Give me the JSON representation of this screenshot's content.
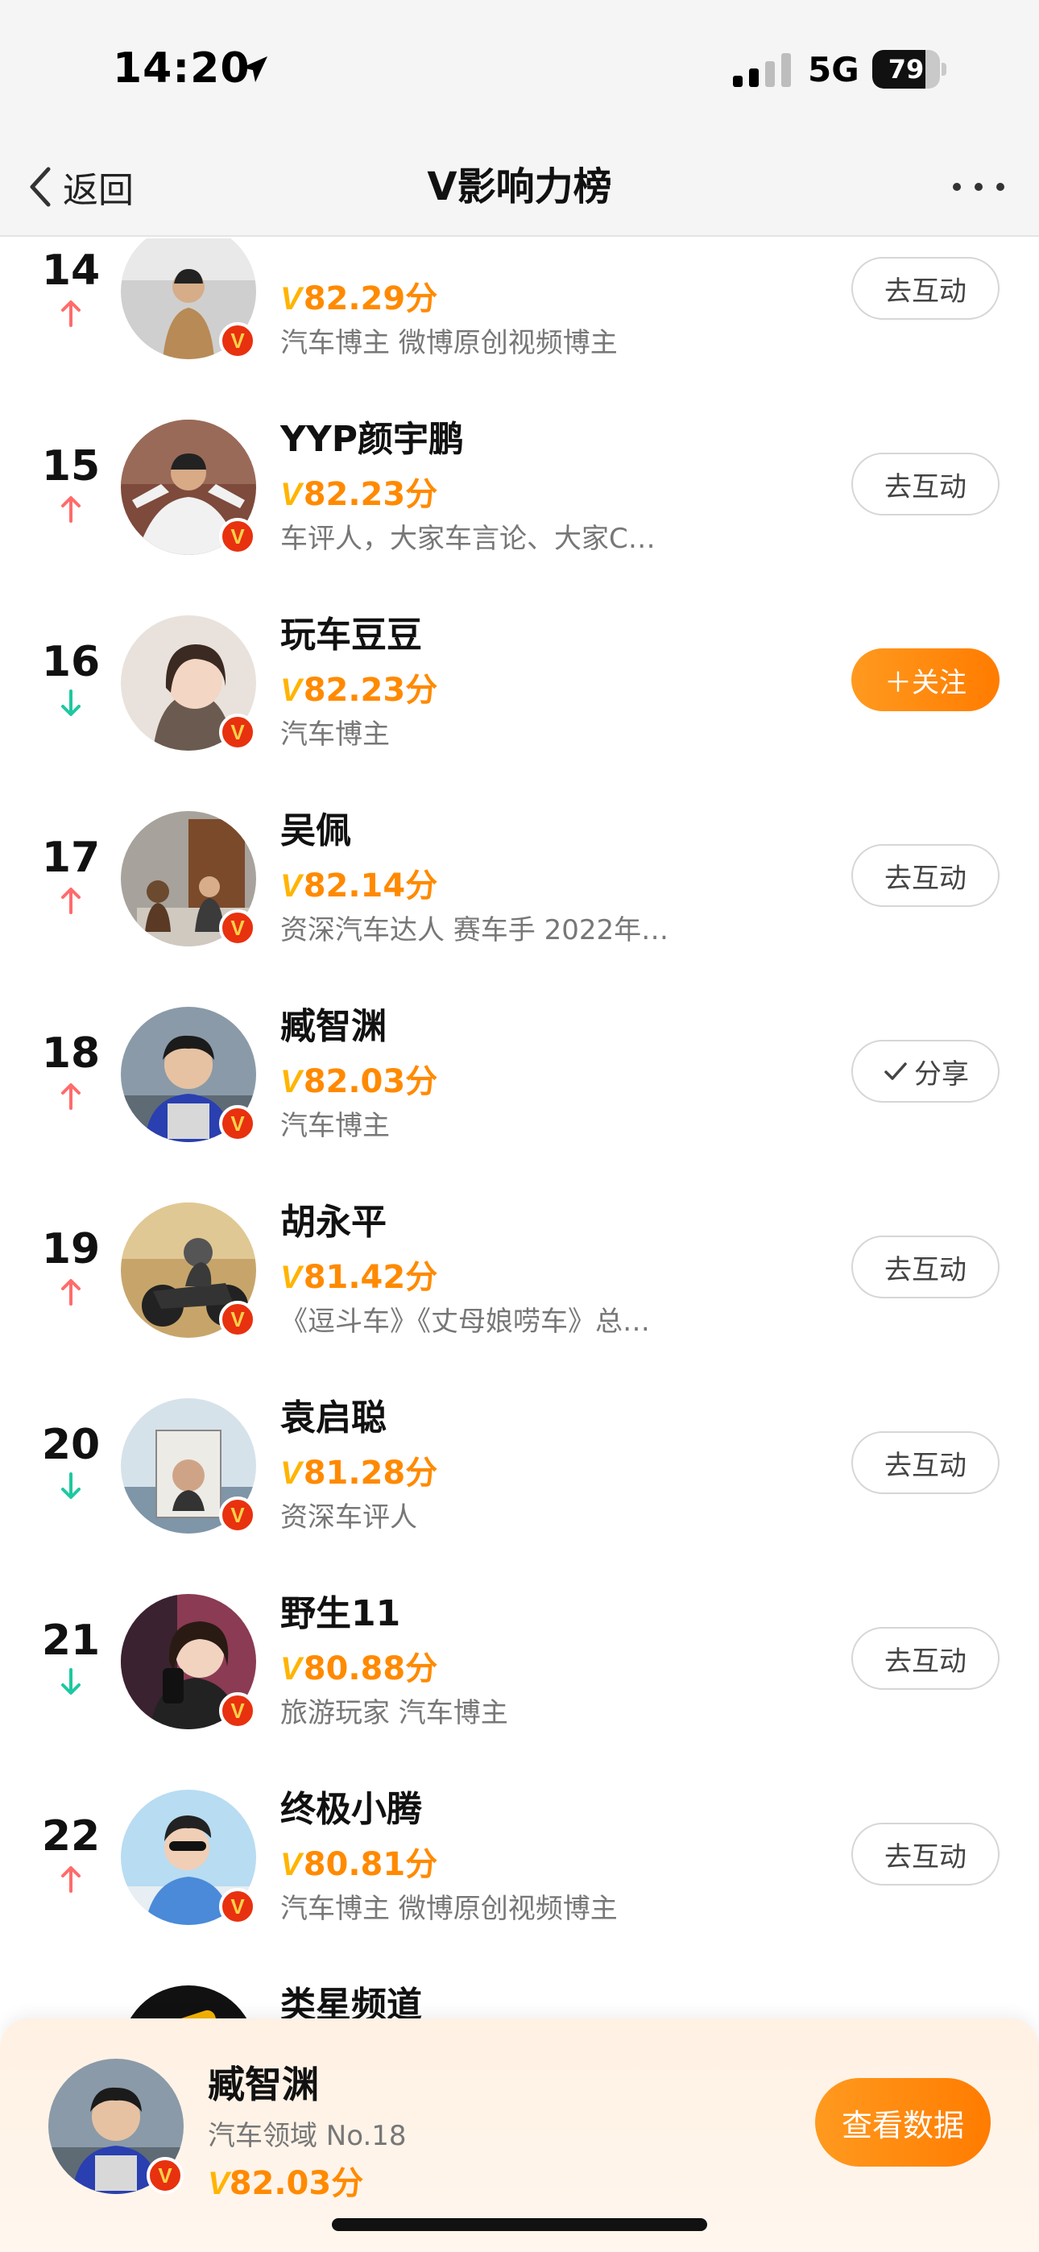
{
  "status_bar": {
    "time": "14:20",
    "network": "5G",
    "battery": "79",
    "battery_level": 0.79
  },
  "nav": {
    "back_label": "返回",
    "title": "V影响力榜"
  },
  "list": [
    {
      "rank": "14",
      "trend": "up",
      "name": "",
      "score": "82.29分",
      "desc": "汽车博主 微博原创视频博主",
      "button": "去互动",
      "button_type": "interact"
    },
    {
      "rank": "15",
      "trend": "up",
      "name": "YYP颜宇鹏",
      "score": "82.23分",
      "desc": "车评人，大家车言论、大家C…",
      "button": "去互动",
      "button_type": "interact"
    },
    {
      "rank": "16",
      "trend": "down",
      "name": "玩车豆豆",
      "score": "82.23分",
      "desc": "汽车博主",
      "button": "＋关注",
      "button_type": "follow"
    },
    {
      "rank": "17",
      "trend": "up",
      "name": "吴佩",
      "score": "82.14分",
      "desc": "资深汽车达人 赛车手 2022年…",
      "button": "去互动",
      "button_type": "interact"
    },
    {
      "rank": "18",
      "trend": "up",
      "name": "臧智渊",
      "score": "82.03分",
      "desc": "汽车博主",
      "button": "分享",
      "button_type": "share"
    },
    {
      "rank": "19",
      "trend": "up",
      "name": "胡永平",
      "score": "81.42分",
      "desc": "《逗斗车》《丈母娘唠车》总…",
      "button": "去互动",
      "button_type": "interact"
    },
    {
      "rank": "20",
      "trend": "down",
      "name": "袁启聪",
      "score": "81.28分",
      "desc": "资深车评人",
      "button": "去互动",
      "button_type": "interact"
    },
    {
      "rank": "21",
      "trend": "down",
      "name": "野生11",
      "score": "80.88分",
      "desc": "旅游玩家 汽车博主",
      "button": "去互动",
      "button_type": "interact"
    },
    {
      "rank": "22",
      "trend": "up",
      "name": "终极小腾",
      "score": "80.81分",
      "desc": "汽车博主 微博原创视频博主",
      "button": "去互动",
      "button_type": "interact"
    },
    {
      "rank": "",
      "trend": "none",
      "name": "类星频道",
      "score": "",
      "desc": "",
      "button": "",
      "button_type": "interact"
    }
  ],
  "badge": "V",
  "score_prefix": "V",
  "bottom_card": {
    "name": "臧智渊",
    "domain": "汽车领域 No.18",
    "score": "82.03分",
    "button": "查看数据"
  },
  "colors": {
    "accent": "#ff8a00",
    "up": "#ff6b6b",
    "down": "#1ec8a0",
    "badge": "#e8310f"
  }
}
